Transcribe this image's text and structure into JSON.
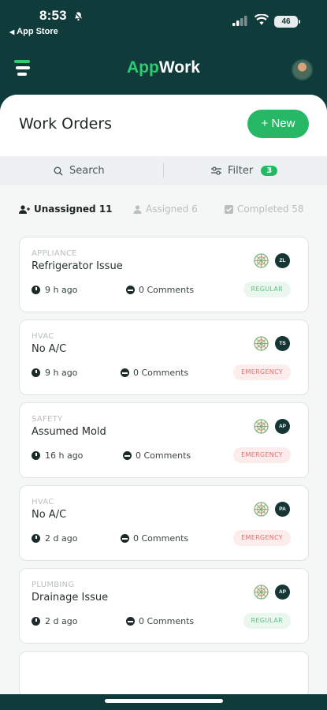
{
  "status_bar": {
    "time": "8:53",
    "back_label": "App Store",
    "battery": "46"
  },
  "header": {
    "brand_part1": "App",
    "brand_part2": "Work",
    "accent_color": "#2ecc71"
  },
  "page": {
    "title": "Work Orders",
    "new_button": "+ New"
  },
  "toolbar": {
    "search_label": "Search",
    "filter_label": "Filter",
    "filter_count": "3"
  },
  "tabs": [
    {
      "label": "Unassigned 11",
      "active": true
    },
    {
      "label": "Assigned 6",
      "active": false
    },
    {
      "label": "Completed 58",
      "active": false
    }
  ],
  "work_orders": [
    {
      "category": "APPLIANCE",
      "title": "Refrigerator Issue",
      "time": "9 h ago",
      "comments": "0 Comments",
      "priority": "REGULAR",
      "assignee": "ZL"
    },
    {
      "category": "HVAC",
      "title": "No A/C",
      "time": "9 h ago",
      "comments": "0 Comments",
      "priority": "EMERGENCY",
      "assignee": "TS"
    },
    {
      "category": "SAFETY",
      "title": "Assumed Mold",
      "time": "16 h ago",
      "comments": "0 Comments",
      "priority": "EMERGENCY",
      "assignee": "AP"
    },
    {
      "category": "HVAC",
      "title": "No A/C",
      "time": "2 d ago",
      "comments": "0 Comments",
      "priority": "EMERGENCY",
      "assignee": "PA"
    },
    {
      "category": "PLUMBING",
      "title": "Drainage Issue",
      "time": "2 d ago",
      "comments": "0 Comments",
      "priority": "REGULAR",
      "assignee": "AP"
    }
  ]
}
